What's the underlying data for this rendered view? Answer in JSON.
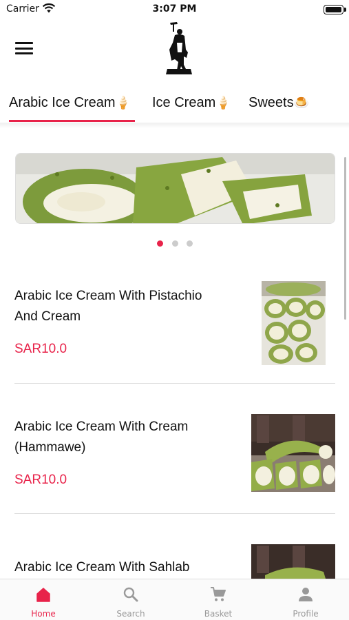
{
  "status_bar": {
    "carrier": "Carrier",
    "time": "3:07 PM"
  },
  "header": {
    "menu_icon": "hamburger-menu-icon",
    "logo": "brand-logo"
  },
  "tabs": [
    {
      "label": "Arabic Ice Cream",
      "emoji": "🍦",
      "active": true
    },
    {
      "label": "Ice Cream",
      "emoji": "🍦",
      "active": false
    },
    {
      "label": "Sweets",
      "emoji": "🍮",
      "active": false
    }
  ],
  "banner": {
    "slides": 3,
    "active_slide": 1
  },
  "colors": {
    "accent": "#e8234a",
    "pistachio": "#7a9a3a",
    "cream": "#f3efe0"
  },
  "products": [
    {
      "name_line1": "Arabic Ice Cream With Pistachio",
      "name_line2": "And Cream",
      "price": "SAR10.0"
    },
    {
      "name_line1": "Arabic Ice Cream With Cream",
      "name_line2": "(Hammawe)",
      "price": "SAR10.0"
    },
    {
      "name_line1": "Arabic Ice Cream With Sahlab",
      "name_line2": "",
      "price": ""
    }
  ],
  "bottom_nav": [
    {
      "label": "Home",
      "icon": "home-icon",
      "active": true
    },
    {
      "label": "Search",
      "icon": "search-icon",
      "active": false
    },
    {
      "label": "Basket",
      "icon": "cart-icon",
      "active": false
    },
    {
      "label": "Profile",
      "icon": "person-icon",
      "active": false
    }
  ]
}
